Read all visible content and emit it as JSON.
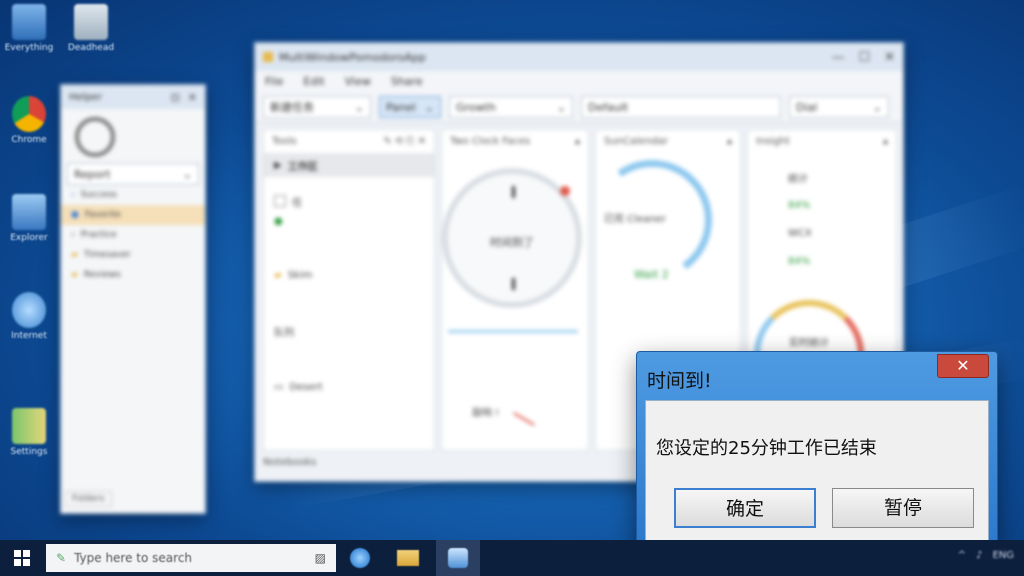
{
  "desktop": {
    "icons": [
      {
        "label": "Everything",
        "icon": "computer-icon"
      },
      {
        "label": "Deadhead",
        "icon": "recycle-bin-icon"
      },
      {
        "label": "Chrome",
        "icon": "chrome-icon"
      },
      {
        "label": "Explorer",
        "icon": "network-icon"
      },
      {
        "label": "Internet",
        "icon": "globe-icon"
      },
      {
        "label": "Settings",
        "icon": "folder-icon"
      }
    ]
  },
  "background_window": {
    "title": "MultiWindowPomodoroApp",
    "menu": [
      "File",
      "Edit",
      "View",
      "Share"
    ],
    "toolbar": {
      "combo1": "新建任务",
      "button": "Panel",
      "combo2": "Growth",
      "combo3": "Default",
      "combo4": "Dial"
    },
    "list_panel": {
      "header": "Tools",
      "selected": "工作区",
      "items": [
        "任",
        "Skim",
        "队列",
        "Desert"
      ],
      "status": "Notebooks"
    },
    "clock_panel": {
      "title": "Two Clock Faces",
      "center": "时间到了"
    },
    "progress_panel": {
      "title": "SunCalendar",
      "center": "已完 Cleaner",
      "value": "Wait 2"
    },
    "stats_panel": {
      "title": "Insight",
      "rows": [
        "统计",
        "84%",
        "WCX",
        "84%"
      ],
      "gauge": "实时统计"
    }
  },
  "side_window": {
    "title": "Helper",
    "field": "Report",
    "items": [
      "Success",
      "Favorite",
      "Practice",
      "Timesaver",
      "Reviews"
    ],
    "status": "Folders"
  },
  "dialog": {
    "title": "时间到!",
    "close": "✕",
    "message": "您设定的25分钟工作已结束",
    "confirm": "确定",
    "pause": "暂停"
  },
  "taskbar": {
    "search_text": "Type here to search",
    "tray": [
      "^",
      "♪",
      "ENG"
    ]
  },
  "colors": {
    "dialog_frame": "#2b78cc",
    "close_button": "#c94a3c",
    "taskbar": "#0c1f3d"
  }
}
